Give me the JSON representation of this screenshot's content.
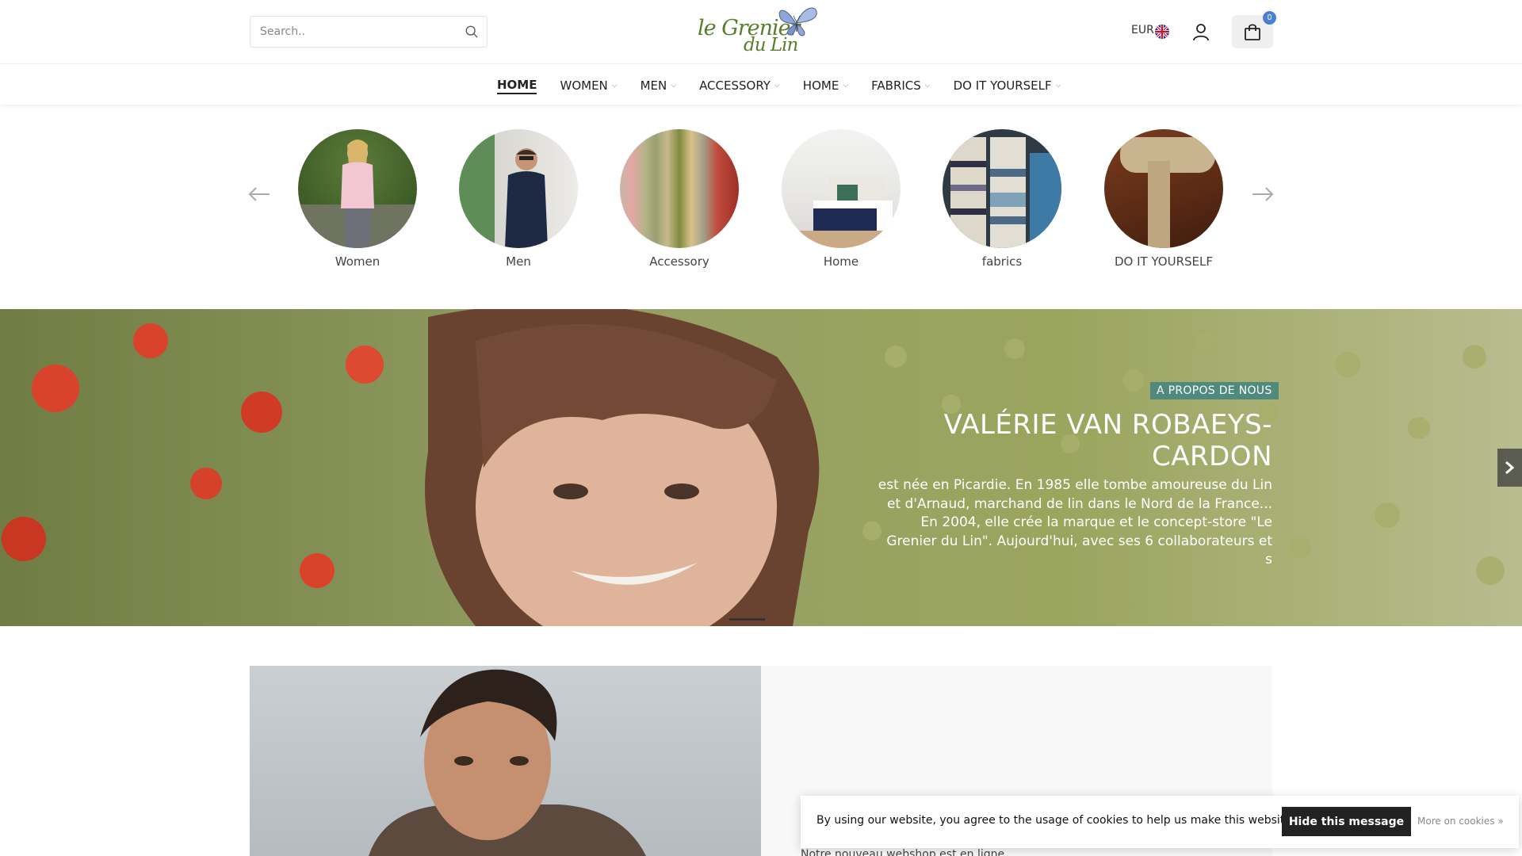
{
  "search": {
    "placeholder": "Search.."
  },
  "logo": {
    "line1": "le Grenier",
    "line2": "du Lin"
  },
  "header": {
    "currency": "EUR",
    "cart_count": "0"
  },
  "nav": {
    "items": [
      {
        "label": "HOME",
        "active": true,
        "dropdown": false
      },
      {
        "label": "WOMEN",
        "dropdown": true
      },
      {
        "label": "MEN",
        "dropdown": true
      },
      {
        "label": "ACCESSORY",
        "dropdown": true
      },
      {
        "label": "HOME",
        "dropdown": true
      },
      {
        "label": "FABRICS",
        "dropdown": true
      },
      {
        "label": "DO IT YOURSELF",
        "dropdown": true
      }
    ]
  },
  "categories": [
    {
      "label": "Women"
    },
    {
      "label": "Men"
    },
    {
      "label": "Accessory"
    },
    {
      "label": "Home"
    },
    {
      "label": "fabrics"
    },
    {
      "label": "DO IT YOURSELF"
    }
  ],
  "hero": {
    "tag": "A PROPOS DE NOUS",
    "title": "VALÉRIE VAN ROBAEYS-CARDON",
    "text": "est née en Picardie. En 1985 elle tombe amoureuse du Lin et d'Arnaud, marchand de lin dans le Nord de la France... En 2004, elle crée la marque et le concept-store \"Le Grenier du Lin\". Aujourd'hui, avec ses 6 collaborateurs et s"
  },
  "promo": {
    "text": "Notre nouveau webshop est en ligne"
  },
  "cookie": {
    "message": "By using our website, you agree to the usage of cookies to help us make this website better.",
    "hide_label": "Hide this message",
    "more_label": "More on cookies »"
  },
  "colors": {
    "accent_tag": "#4f8a7c",
    "cart_badge": "#4a7fd6",
    "logo_green": "#5a7d2c"
  }
}
